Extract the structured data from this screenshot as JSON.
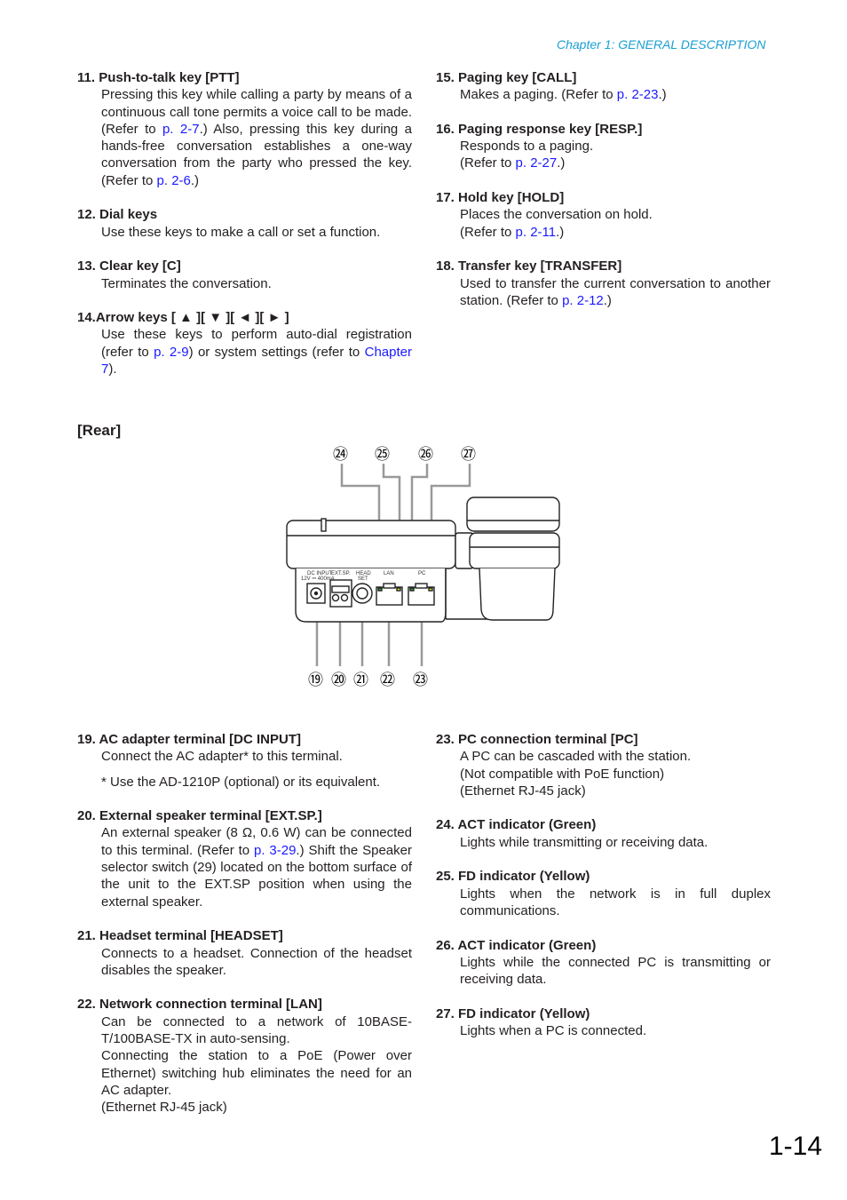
{
  "header": {
    "chapter": "Chapter 1:  GENERAL DESCRIPTION"
  },
  "colors": {
    "header_accent": "#1aa0d2",
    "link": "#1a1aff",
    "text": "#231f20",
    "callout_line": "#999999"
  },
  "top_left": [
    {
      "title": "11. Push-to-talk key [PTT]",
      "body": [
        "Pressing this key while calling a party by means of a continuous call tone permits a voice call to be made. (Refer to ",
        {
          "link": "p. 2-7"
        },
        ".) Also, pressing this key during a hands-free conversation establishes a one-way conversation from the party who pressed the key. (Refer to ",
        {
          "link": "p. 2-6"
        },
        ".)"
      ]
    },
    {
      "title": "12. Dial keys",
      "body": [
        "Use these keys to make a call or set a function."
      ]
    },
    {
      "title": "13. Clear key [C]",
      "body": [
        "Terminates the conversation."
      ]
    },
    {
      "title": "14.Arrow keys [ ▲ ][ ▼ ][ ◄ ][ ► ]",
      "body": [
        "Use these keys to perform auto-dial registration (refer to ",
        {
          "link": "p. 2-9"
        },
        ") or system settings (refer to ",
        {
          "link": "Chapter 7"
        },
        ")."
      ]
    }
  ],
  "top_right": [
    {
      "title": "15. Paging key [CALL]",
      "body": [
        "Makes a paging. (Refer to ",
        {
          "link": "p. 2-23"
        },
        ".)"
      ]
    },
    {
      "title": "16. Paging response key [RESP.]",
      "body": [
        "Responds to a paging.",
        {
          "br": true
        },
        "(Refer to ",
        {
          "link": "p. 2-27"
        },
        ".)"
      ]
    },
    {
      "title": "17. Hold key [HOLD]",
      "body": [
        "Places the conversation on hold.",
        {
          "br": true
        },
        "(Refer to ",
        {
          "link": "p. 2-11"
        },
        ".)"
      ]
    },
    {
      "title": "18. Transfer key [TRANSFER]",
      "body": [
        "Used to transfer the current conversation to another station. (Refer to ",
        {
          "link": "p. 2-12"
        },
        ".)"
      ]
    }
  ],
  "rear": {
    "title": "[Rear]",
    "callouts_top": [
      "㉔",
      "㉕",
      "㉖",
      "㉗"
    ],
    "callouts_bottom": [
      "⑲",
      "⑳",
      "㉑",
      "㉒",
      "㉓"
    ],
    "panel_labels": {
      "dc_input": "DC INPUT",
      "dc_rating": "12V ⎓ 400mA",
      "ext_sp": "EXT.SP.",
      "head": "HEAD",
      "set": "SET",
      "lan": "LAN",
      "pc": "PC"
    }
  },
  "bottom_left": [
    {
      "title": "19. AC adapter terminal [DC INPUT]",
      "body": [
        "Connect the AC adapter* to this terminal."
      ],
      "note": "* Use the AD-1210P (optional) or its equivalent."
    },
    {
      "title": "20. External speaker terminal [EXT.SP.]",
      "body": [
        "An external speaker (8 Ω, 0.6 W) can be connected to this terminal. (Refer to ",
        {
          "link": "p. 3-29"
        },
        ".) Shift the Speaker selector switch (29) located on the bottom surface of the unit to the EXT.SP position when using the external speaker."
      ]
    },
    {
      "title": "21. Headset terminal [HEADSET]",
      "body": [
        "Connects to a headset. Connection of the headset disables the speaker."
      ]
    },
    {
      "title": "22. Network connection terminal [LAN]",
      "body": [
        "Can be connected to a network of 10BASE-T/100BASE-TX in auto-sensing.",
        {
          "br": true
        },
        "Connecting the station to a PoE (Power over Ethernet) switching hub eliminates the need for an AC adapter.",
        {
          "br": true
        },
        "(Ethernet RJ-45 jack)"
      ]
    }
  ],
  "bottom_right": [
    {
      "title": "23. PC connection terminal [PC]",
      "body": [
        "A PC can be cascaded with the station.",
        {
          "br": true
        },
        "(Not compatible with PoE function)",
        {
          "br": true
        },
        "(Ethernet RJ-45 jack)"
      ]
    },
    {
      "title": "24. ACT indicator (Green)",
      "body": [
        "Lights while transmitting or receiving data."
      ]
    },
    {
      "title": "25. FD indicator (Yellow)",
      "body": [
        "Lights when the network is in full duplex communications."
      ]
    },
    {
      "title": "26. ACT indicator (Green)",
      "body": [
        "Lights while the connected PC is transmitting or receiving data."
      ]
    },
    {
      "title": "27. FD indicator (Yellow)",
      "body": [
        "Lights when a PC is connected."
      ]
    }
  ],
  "footer": {
    "page_number": "1-14"
  }
}
